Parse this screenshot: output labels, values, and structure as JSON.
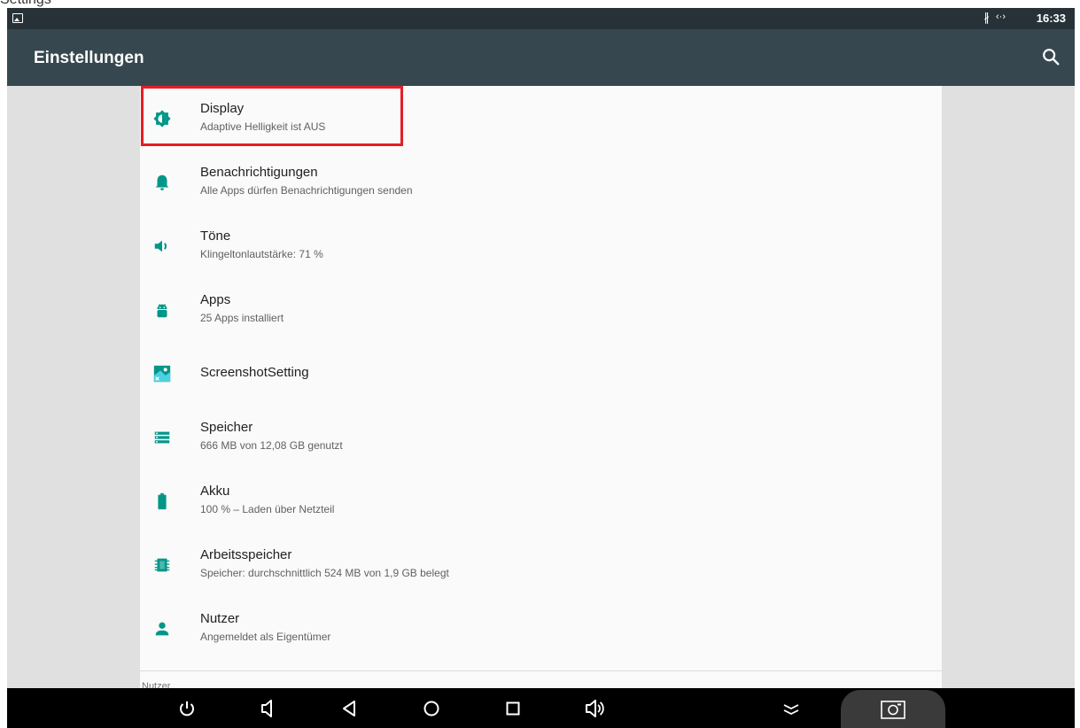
{
  "top_strip_text": "Settings",
  "status_bar": {
    "time": "16:33",
    "bluetooth_glyph": "∦",
    "network_glyph": "‹·›",
    "icons": [
      "notification-icon",
      "bluetooth-icon",
      "network-icon"
    ]
  },
  "app_bar": {
    "title": "Einstellungen",
    "search_icon": "search-icon",
    "background": "#37474f"
  },
  "settings_items": [
    {
      "title": "Display",
      "subtitle": "Adaptive Helligkeit ist AUS",
      "icon": "brightness-icon"
    },
    {
      "title": "Benachrichtigungen",
      "subtitle": "Alle Apps dürfen Benachrichtigungen senden",
      "icon": "bell-icon"
    },
    {
      "title": "Töne",
      "subtitle": "Klingeltonlautstärke: 71 %",
      "icon": "volume-icon"
    },
    {
      "title": "Apps",
      "subtitle": "25 Apps installiert",
      "icon": "android-icon"
    },
    {
      "title": "ScreenshotSetting",
      "subtitle": "",
      "icon": "screenshot-app-icon"
    },
    {
      "title": "Speicher",
      "subtitle": "666 MB von 12,08 GB genutzt",
      "icon": "storage-icon"
    },
    {
      "title": "Akku",
      "subtitle": "100 % – Laden über Netzteil",
      "icon": "battery-icon"
    },
    {
      "title": "Arbeitsspeicher",
      "subtitle": "Speicher: durchschnittlich 524 MB von 1,9 GB belegt",
      "icon": "memory-icon"
    },
    {
      "title": "Nutzer",
      "subtitle": "Angemeldet als Eigentümer",
      "icon": "person-icon"
    }
  ],
  "next_section_label": "Nutzer",
  "nav_bar": {
    "buttons": [
      "power-icon",
      "volume-down-icon",
      "back-icon",
      "home-icon",
      "recents-icon",
      "volume-up-icon",
      "collapse-icon",
      "screenshot-icon"
    ]
  },
  "colors": {
    "accent": "#009688",
    "highlight_box": "#e41e26",
    "status_bar": "#263238"
  }
}
